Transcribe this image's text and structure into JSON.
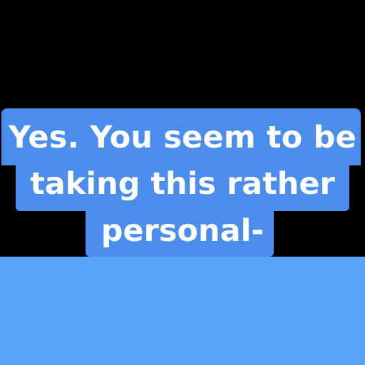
{
  "caption": {
    "lines": [
      "Yes. You seem to be",
      "taking this rather",
      "personal-"
    ]
  },
  "colors": {
    "background_top": "#000000",
    "background_bottom": "#58a2f7",
    "caption_box": "#4a8ded",
    "caption_text": "#ffffff"
  }
}
